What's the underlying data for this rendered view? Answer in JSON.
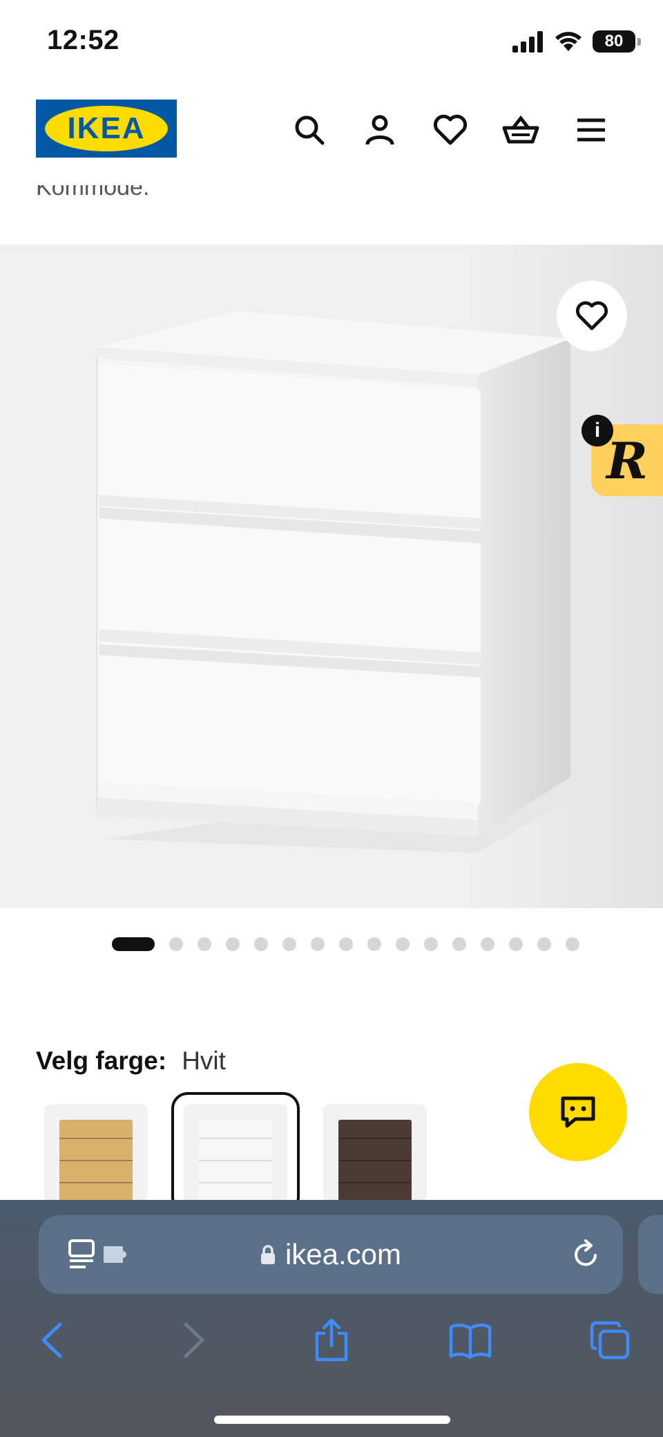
{
  "status_bar": {
    "time": "12:52",
    "battery": "80"
  },
  "header": {
    "logo_text": "IKEA",
    "icons": [
      "search-icon",
      "account-icon",
      "heart-icon",
      "basket-icon",
      "menu-icon"
    ]
  },
  "scrolled_text": "Kommode.",
  "gallery": {
    "image": "white-3-drawer-chest",
    "dots_total": 16,
    "active_dot": 1
  },
  "color_select": {
    "label": "Velg farge:",
    "value": "Hvit",
    "options": [
      {
        "name": "bjorkemonstret-eik-icon",
        "color": "#d9b06a"
      },
      {
        "name": "hvit-icon",
        "color": "#f7f7f5"
      },
      {
        "name": "brunbeis-ask-icon",
        "color": "#4b3b33"
      }
    ],
    "selected_index": 1
  },
  "browser": {
    "url": "ikea.com"
  },
  "colors": {
    "ikea_blue": "#0058a3",
    "ikea_yellow": "#ffdb00",
    "safari_blue": "#3f8cff"
  }
}
